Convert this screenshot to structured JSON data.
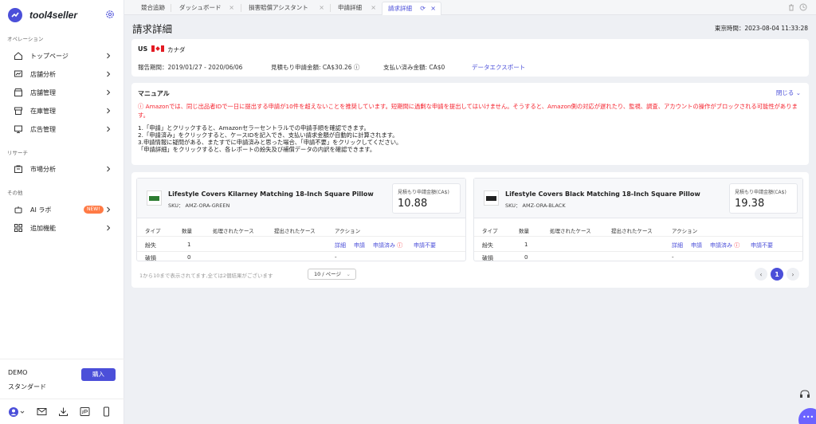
{
  "app": {
    "name": "tool4seller"
  },
  "sidebar": {
    "sections": {
      "operations": "オペレーション",
      "research": "リサーチ",
      "other": "その他"
    },
    "items": [
      {
        "label": "トップページ",
        "icon": "home-icon"
      },
      {
        "label": "店舗分析",
        "icon": "chart-icon"
      },
      {
        "label": "店舗管理",
        "icon": "store-icon"
      },
      {
        "label": "在庫管理",
        "icon": "box-icon"
      },
      {
        "label": "広告管理",
        "icon": "monitor-icon"
      },
      {
        "label": "市場分析",
        "icon": "bag-icon"
      },
      {
        "label": "AI ラボ",
        "icon": "robot-icon",
        "badge": "NEW!"
      },
      {
        "label": "追加機能",
        "icon": "grid-icon"
      }
    ],
    "plan": {
      "name": "DEMO",
      "tier": "スタンダード",
      "buy_label": "購入"
    }
  },
  "tabs": [
    {
      "label": "競合追跡"
    },
    {
      "label": "ダッシュボード"
    },
    {
      "label": "損害賠償アシスタント"
    },
    {
      "label": "申請詳細"
    },
    {
      "label": "請求詳細",
      "active": true
    }
  ],
  "page": {
    "title": "請求詳細",
    "time_label": "東京時間：2023-08-04 11:33:28"
  },
  "summary": {
    "market": "US",
    "country": "カナダ",
    "period": "報告期間：2019/01/27 - 2020/06/06",
    "estimate": "見積もり申請金額: CA$30.26",
    "paid": "支払い済み金額: CA$0",
    "export": "データエクスポート"
  },
  "manual": {
    "title": "マニュアル",
    "toggle": "閉じる",
    "warning": "Amazonでは、同じ出品者IDで一日に提出する申請が10件を超えないことを推奨しています。短期間に過剰な申請を提出してはいけません。そうすると、Amazon側の対応が遅れたり、監視、調査、アカウントの操作がブロックされる可能性があります。",
    "steps": [
      "1.「申請」とクリックすると、Amazonセラーセントラルでの申請手順を確認できます。",
      "2.「申請済み」をクリックすると、ケースIDを記入でき、支払い請求金額が自動的に計算されます。",
      "3.申請情報に疑問がある、またすでに申請済みと思った場合、「申請不要」をクリックしてください。",
      "「申請詳細」をクリックすると、各レポートの紛失及び補償データの内訳を確認できます。"
    ]
  },
  "table_headers": [
    "タイプ",
    "数量",
    "処理されたケース",
    "提出されたケース",
    "アクション"
  ],
  "actions": [
    "詳細",
    "申請",
    "申請済み",
    "申請不要"
  ],
  "products": [
    {
      "name": "Lifestyle Covers Kilarney Matching 18-Inch Square Pillow",
      "sku": "SKU： AMZ-ORA-GREEN",
      "amount_label": "見積もり申請金額(CA$)",
      "amount": "10.88",
      "color": "#2e7d32",
      "rows": [
        {
          "type": "紛失",
          "qty": "1"
        },
        {
          "type": "破損",
          "qty": "0",
          "action": "-"
        }
      ]
    },
    {
      "name": "Lifestyle Covers Black Matching 18-Inch Square Pillow",
      "sku": "SKU： AMZ-ORA-BLACK",
      "amount_label": "見積もり申請金額(CA$)",
      "amount": "19.38",
      "color": "#222222",
      "rows": [
        {
          "type": "紛失",
          "qty": "1"
        },
        {
          "type": "破損",
          "qty": "0",
          "action": "-"
        }
      ]
    }
  ],
  "pagination": {
    "summary": "1から10まで表示されてます,全ては2個結果がございます",
    "page_size": "10 / ページ",
    "current": "1"
  },
  "colors": {
    "accent": "#4b4fd9",
    "danger": "#f5222d",
    "badge": "#ff7a45"
  }
}
